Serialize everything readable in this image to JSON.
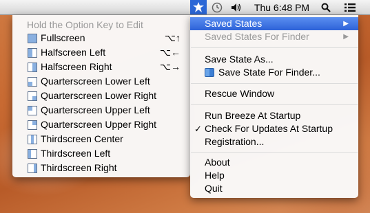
{
  "menubar": {
    "breeze_icon": "breeze-star-icon",
    "time_machine_icon": "clock-icon",
    "volume_icon": "speaker-icon",
    "clock": "Thu 6:48 PM",
    "spotlight_icon": "magnifier-icon",
    "list_icon": "list-icon",
    "accent": "#2b67d6"
  },
  "main_menu": {
    "saved_states": "Saved States",
    "saved_states_finder": "Saved States For Finder",
    "save_state_as": "Save State As...",
    "save_state_finder": "Save State For Finder...",
    "rescue_window": "Rescue Window",
    "run_at_startup": "Run Breeze At Startup",
    "check_updates": "Check For Updates At Startup",
    "registration": "Registration...",
    "about": "About",
    "help": "Help",
    "quit": "Quit"
  },
  "sub_menu": {
    "header": "Hold the Option Key to Edit",
    "items": [
      {
        "label": "Fullscreen",
        "shortcut": "⌥↑"
      },
      {
        "label": "Halfscreen Left",
        "shortcut": "⌥←"
      },
      {
        "label": "Halfscreen Right",
        "shortcut": "⌥→"
      },
      {
        "label": "Quarterscreen Lower Left",
        "shortcut": ""
      },
      {
        "label": "Quarterscreen Lower Right",
        "shortcut": ""
      },
      {
        "label": "Quarterscreen Upper Left",
        "shortcut": ""
      },
      {
        "label": "Quarterscreen Upper Right",
        "shortcut": ""
      },
      {
        "label": "Thirdscreen Center",
        "shortcut": ""
      },
      {
        "label": "Thirdscreen Left",
        "shortcut": ""
      },
      {
        "label": "Thirdscreen Right",
        "shortcut": ""
      }
    ]
  }
}
